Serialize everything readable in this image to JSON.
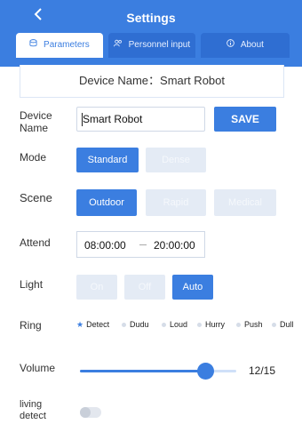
{
  "header": {
    "back_icon": "chevron-left-icon",
    "title": "Settings"
  },
  "tabs": [
    {
      "label": "Parameters",
      "icon": "database-icon",
      "active": true
    },
    {
      "label": "Personnel input",
      "icon": "people-icon",
      "active": false
    },
    {
      "label": "About",
      "icon": "info-icon",
      "active": false
    }
  ],
  "device_bar": {
    "text": "Device Name：Smart Robot"
  },
  "device_name": {
    "label": "Device\nName",
    "value": "Smart Robot",
    "save_label": "SAVE"
  },
  "mode": {
    "label": "Mode",
    "options": [
      "Standard",
      "Dense"
    ],
    "selected": "Standard"
  },
  "scene": {
    "label": "Scene",
    "options": [
      "Outdoor",
      "Rapid",
      "Medical"
    ],
    "selected": "Outdoor"
  },
  "attend": {
    "label": "Attend",
    "start": "08:00:00",
    "end": "20:00:00"
  },
  "light": {
    "label": "Light",
    "options": [
      "On",
      "Off",
      "Auto"
    ],
    "selected": "Auto"
  },
  "ring": {
    "label": "Ring",
    "options": [
      "Detect",
      "Dudu",
      "Loud",
      "Hurry",
      "Push",
      "Dull"
    ],
    "selected": "Detect"
  },
  "volume": {
    "label": "Volume",
    "value": 12,
    "max": 15,
    "display": "12/15"
  },
  "living_detect": {
    "label": "living\ndetect",
    "enabled": false
  },
  "colors": {
    "accent": "#3b7ee0",
    "muted": "#e4ebf5"
  }
}
